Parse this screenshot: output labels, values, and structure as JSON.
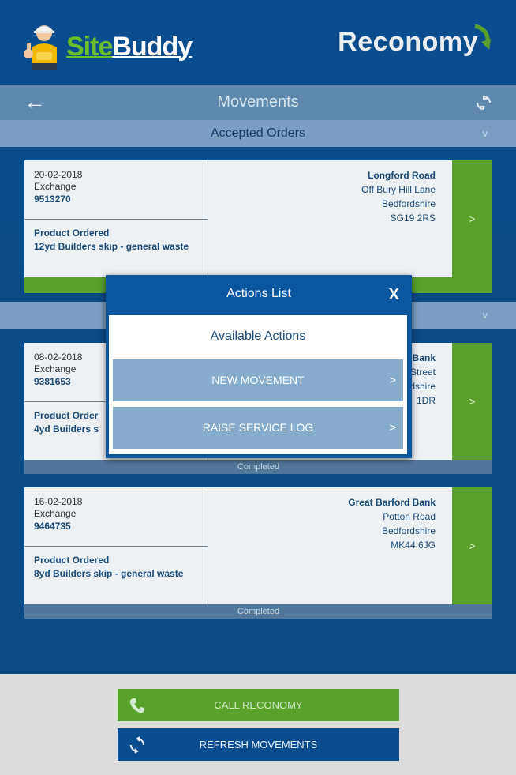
{
  "header": {
    "brand_left_a": "Site",
    "brand_left_b": "Buddy",
    "brand_right": "Reconomy"
  },
  "titlebar": {
    "back_icon": "arrow-left-icon",
    "title": "Movements",
    "refresh_icon": "sync-icon"
  },
  "sections": [
    {
      "title": "Accepted Orders",
      "chevron": "v"
    },
    {
      "title": "",
      "chevron": "v"
    }
  ],
  "cards": [
    {
      "date": "20-02-2018",
      "type": "Exchange",
      "ref": "9513270",
      "product_label": "Product Ordered",
      "product": "12yd Builders skip - general waste",
      "road": "Longford Road",
      "addr1": "Off Bury Hill Lane",
      "addr2": "Bedfordshire",
      "postcode": "SG19 2RS",
      "go": ">"
    },
    {
      "date": "08-02-2018",
      "type": "Exchange",
      "ref": "9381653",
      "product_label": "Product Order",
      "product": "4yd Builders s",
      "road": "Bank",
      "addr1": "Street",
      "addr2": "dshire",
      "postcode": "1DR",
      "go": ">",
      "status": "Completed"
    },
    {
      "date": "16-02-2018",
      "type": "Exchange",
      "ref": "9464735",
      "product_label": "Product Ordered",
      "product": "8yd Builders skip - general waste",
      "road": "Great Barford Bank",
      "addr1": "Potton Road",
      "addr2": "Bedfordshire",
      "postcode": "MK44 6JG",
      "go": ">",
      "status": "Completed"
    }
  ],
  "modal": {
    "title": "Actions List",
    "close": "X",
    "subtitle": "Available Actions",
    "actions": [
      {
        "label": "NEW MOVEMENT",
        "chevron": ">"
      },
      {
        "label": "RAISE SERVICE LOG",
        "chevron": ">"
      }
    ]
  },
  "footer": {
    "call_label": "CALL RECONOMY",
    "call_icon": "phone-icon",
    "refresh_label": "REFRESH MOVEMENTS",
    "refresh_icon": "sync-icon"
  },
  "colors": {
    "primary": "#0a4d8e",
    "accent_green": "#58a12a",
    "action_blue": "#86abcd"
  }
}
